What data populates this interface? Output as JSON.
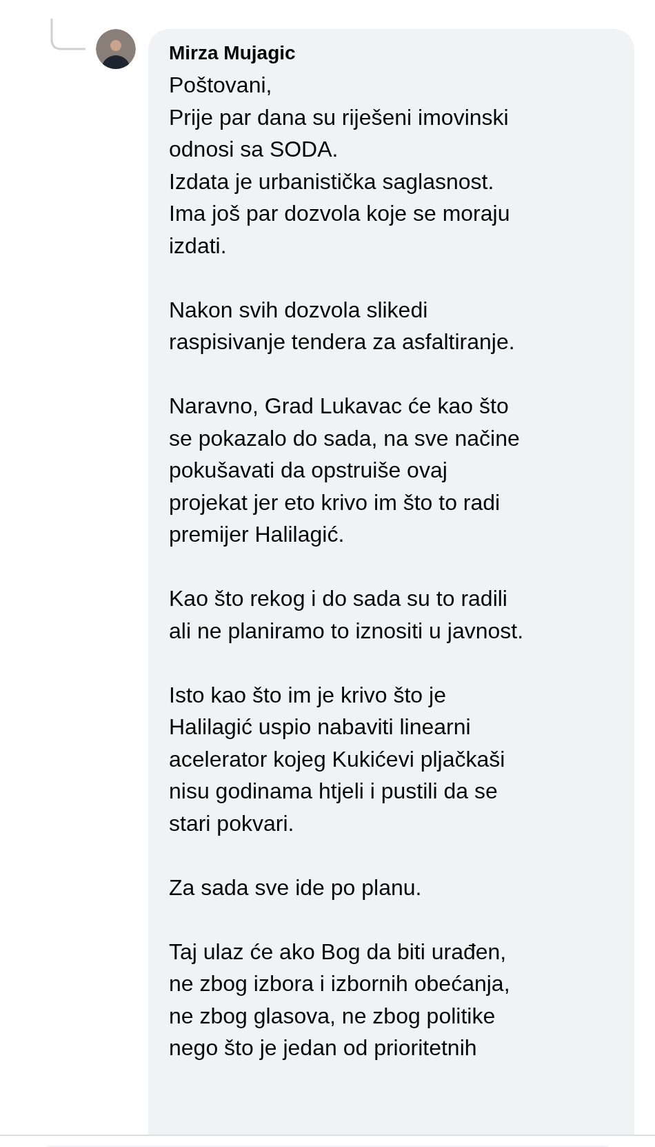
{
  "comment": {
    "author": "Mirza Mujagic",
    "paragraphs": [
      "Poštovani,\nPrije par dana su riješeni imovinski\nodnosi sa SODA.\nIzdata je urbanistička saglasnost.\nIma još par dozvola koje se moraju\nizdati.",
      "Nakon svih dozvola slikedi\nraspisivanje tendera za asfaltiranje.",
      "Naravno, Grad Lukavac će kao što\nse pokazalo do sada, na sve načine\npokušavati da opstruiše ovaj\nprojekat jer eto krivo im što to radi\npremijer Halilagić.",
      "Kao što rekog i do sada su to radili\nali ne planiramo to iznositi u javnost.",
      "Isto kao što im je krivo što je\nHalilagić uspio nabaviti linearni\nacelerator kojeg Kukićevi pljačkaši\nnisu godinama htjeli i pustili da se\nstari pokvari.",
      "Za sada sve ide po planu.",
      "Taj ulaz će ako Bog da biti urađen,\nne zbog izbora i izbornih obećanja,\nne zbog glasova, ne zbog politike\nnego što je jedan od prioritetnih"
    ]
  }
}
